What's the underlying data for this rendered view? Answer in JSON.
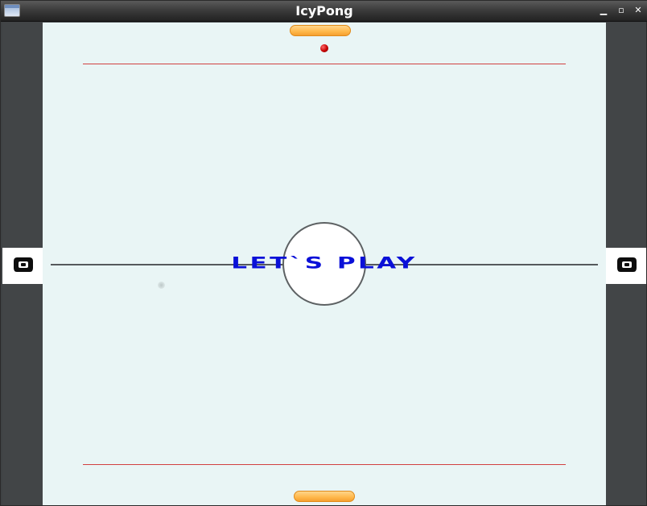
{
  "window": {
    "title": "IcyPong",
    "minimize_glyph": "▁",
    "maximize_glyph": "▫",
    "close_glyph": "✕"
  },
  "game": {
    "banner": "LET`S PLAY"
  },
  "colors": {
    "field": "#e9f5f5",
    "sides": "#424547",
    "paddle": "#ffb84a",
    "ball": "#c40000",
    "goal_line": "#d14040",
    "banner_text": "#0a10d8"
  },
  "icons": {
    "app": "window-app-icon",
    "left_goal": "goal-icon",
    "right_goal": "goal-icon"
  }
}
